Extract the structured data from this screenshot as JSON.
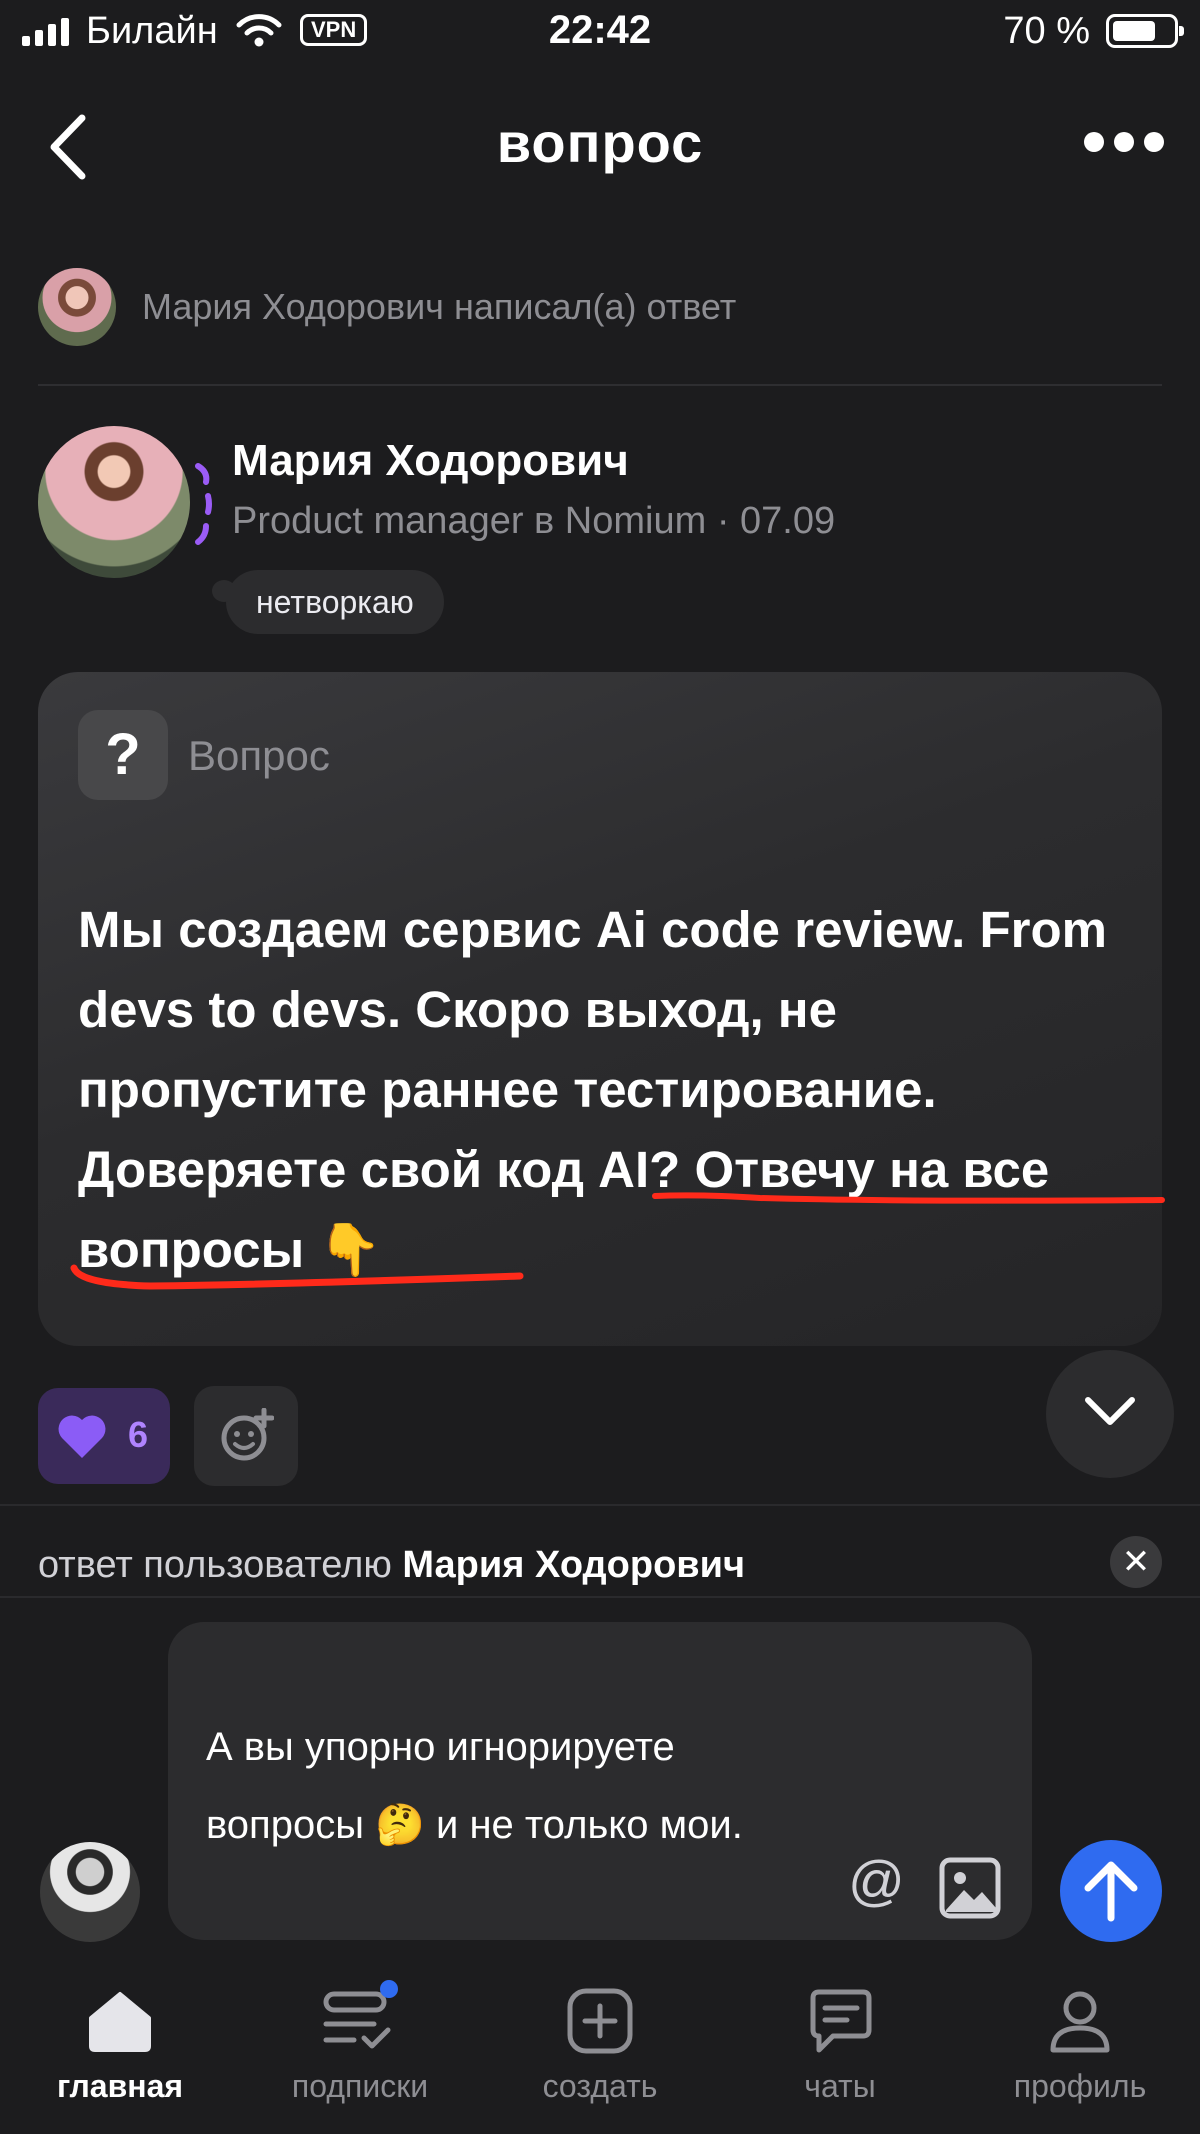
{
  "status_bar": {
    "carrier": "Билайн",
    "vpn": "VPN",
    "time": "22:42",
    "battery": "70 %"
  },
  "header": {
    "title": "вопрос"
  },
  "notification": {
    "text": "Мария Ходорович написал(а) ответ"
  },
  "author": {
    "name": "Мария Ходорович",
    "meta": "Product manager в Nomium · 07.09",
    "status": "нетворкаю"
  },
  "question": {
    "label": "Вопрос",
    "icon": "question-icon",
    "text": "Мы создаем сервис Ai code review. From devs to devs.  Скоро выход, не пропустите раннее тестирование. Доверяете свой код AI? Отвечу на все вопросы 👇"
  },
  "reactions": {
    "like_count": "6",
    "like_color": "#8b5cf6"
  },
  "reply": {
    "prefix": "ответ пользователю ",
    "name": "Мария Ходорович",
    "close": "✕"
  },
  "composer": {
    "text": "А вы упорно игнорируете вопросы 🤔 и не только мои.",
    "mention": "@",
    "send_color": "#2f6bf0"
  },
  "tabs": [
    {
      "label": "главная",
      "icon": "home-icon",
      "active": true
    },
    {
      "label": "подписки",
      "icon": "subscriptions-icon",
      "active": false
    },
    {
      "label": "создать",
      "icon": "create-icon",
      "active": false
    },
    {
      "label": "чаты",
      "icon": "chat-icon",
      "active": false
    },
    {
      "label": "профиль",
      "icon": "profile-icon",
      "active": false
    }
  ]
}
